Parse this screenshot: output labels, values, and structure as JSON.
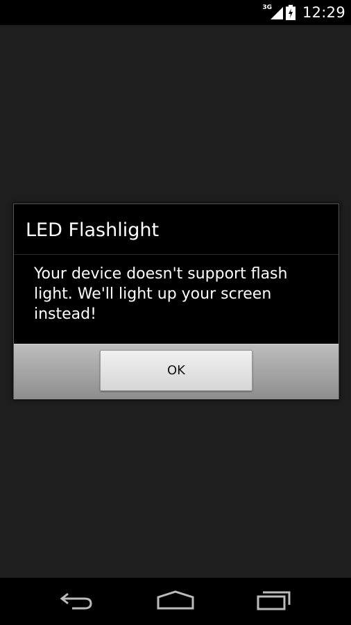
{
  "status_bar": {
    "network_type": "3G",
    "time": "12:29",
    "icons": [
      "signal-icon",
      "battery-icon"
    ]
  },
  "dialog": {
    "title": "LED Flashlight",
    "message": "Your device doesn't support flash light. We'll light up your screen instead!",
    "ok_label": "OK"
  },
  "nav_bar": {
    "icons": [
      "back-icon",
      "home-icon",
      "recents-icon"
    ]
  },
  "colors": {
    "background": "#1e1e1e",
    "dialog_bg": "#000000",
    "button_bar": "#a8a8a8",
    "text": "#ffffff"
  }
}
